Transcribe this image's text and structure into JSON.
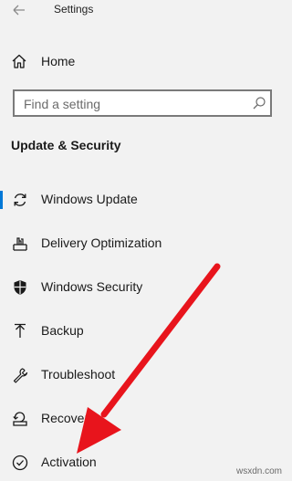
{
  "window": {
    "title": "Settings",
    "back_icon": "back-arrow-icon"
  },
  "home": {
    "label": "Home",
    "icon": "home-icon"
  },
  "search": {
    "placeholder": "Find a setting",
    "value": "",
    "icon": "search-icon"
  },
  "section": {
    "title": "Update & Security"
  },
  "nav": {
    "items": [
      {
        "label": "Windows Update",
        "icon": "sync-icon",
        "selected": true
      },
      {
        "label": "Delivery Optimization",
        "icon": "delivery-optimization-icon"
      },
      {
        "label": "Windows Security",
        "icon": "shield-icon"
      },
      {
        "label": "Backup",
        "icon": "backup-arrow-icon"
      },
      {
        "label": "Troubleshoot",
        "icon": "wrench-icon"
      },
      {
        "label": "Recovery",
        "icon": "recovery-icon"
      },
      {
        "label": "Activation",
        "icon": "check-circle-icon"
      }
    ]
  },
  "annotation": {
    "arrow_color": "#e8141c",
    "points_to": "Activation"
  },
  "colors": {
    "accent": "#0078d7",
    "background": "#f2f2f2"
  },
  "watermark": "wsxdn.com"
}
